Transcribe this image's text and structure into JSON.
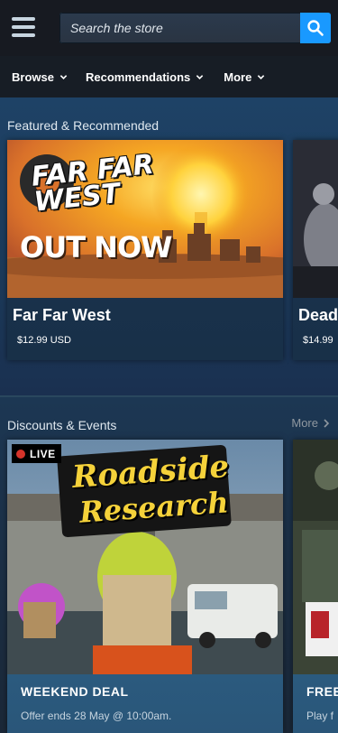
{
  "header": {
    "search_placeholder": "Search the store"
  },
  "nav": {
    "items": [
      {
        "label": "Browse"
      },
      {
        "label": "Recommendations"
      },
      {
        "label": "More"
      }
    ]
  },
  "featured": {
    "title": "Featured & Recommended",
    "cards": [
      {
        "name": "Far Far West",
        "price": "$12.99 USD",
        "art_title": "FAR FAR WEST",
        "art_sub": "OUT NOW"
      },
      {
        "name": "Dead",
        "price": "$14.99"
      }
    ]
  },
  "discounts": {
    "title": "Discounts & Events",
    "more_label": "More",
    "cards": [
      {
        "live_label": "LIVE",
        "art_title_1": "Roadside",
        "art_title_2": "Research",
        "label": "WEEKEND DEAL",
        "sub": "Offer ends 28 May @ 10:00am."
      },
      {
        "label": "FREE",
        "sub": "Play f"
      }
    ]
  },
  "colors": {
    "accent": "#1999ff",
    "header_bg": "#171a21",
    "page_bg": "#1b2838",
    "live_dot": "#d5332a"
  }
}
